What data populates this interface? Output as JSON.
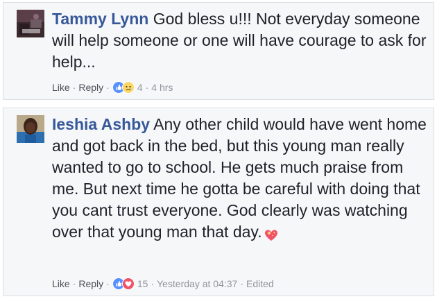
{
  "comments": [
    {
      "author": "Tammy Lynn",
      "text": "God bless u!!! Not everyday someone will help someone or one will have courage to ask for help...",
      "actions": {
        "like_label": "Like",
        "reply_label": "Reply",
        "reaction_count": "4",
        "time": "4 hrs"
      },
      "reactions": [
        "like-icon",
        "sad-icon"
      ]
    },
    {
      "author": "Ieshia Ashby",
      "text": "Any other child would have went home and got back in the bed, but this young man really wanted to go to school. He gets much praise from me. But next time he gotta be careful with doing that you cant trust everyone. God clearly was watching over that young man that day.",
      "emoji": "sparkling-heart-icon",
      "actions": {
        "like_label": "Like",
        "reply_label": "Reply",
        "reaction_count": "15",
        "time": "Yesterday at 04:37",
        "edited_label": "Edited"
      },
      "reactions": [
        "like-icon",
        "love-icon"
      ]
    }
  ],
  "colors": {
    "author": "#365899",
    "text": "#1d2129",
    "meta": "#90949c",
    "background": "#f6f7f9",
    "border": "#dddfe2",
    "like_blue": "#5890ff",
    "love_red": "#f25268",
    "sad_yellow": "#fcd768"
  }
}
